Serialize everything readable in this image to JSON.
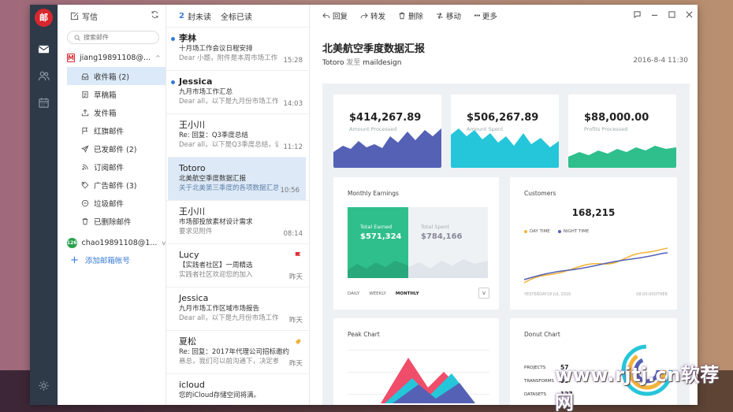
{
  "app": {
    "logo": "邮"
  },
  "sidebar": {
    "compose_label": "写信",
    "search_placeholder": "搜索邮件",
    "account1": "jiang19891108@...",
    "folders": [
      {
        "label": "收件箱 (2)",
        "icon": "inbox-icon"
      },
      {
        "label": "草稿箱",
        "icon": "draft-icon"
      },
      {
        "label": "发件箱",
        "icon": "outbox-icon"
      },
      {
        "label": "红旗邮件",
        "icon": "flag-icon"
      },
      {
        "label": "已发邮件 (2)",
        "icon": "send-icon"
      },
      {
        "label": "订阅邮件",
        "icon": "rss-icon"
      },
      {
        "label": "广告邮件 (3)",
        "icon": "tag-icon"
      },
      {
        "label": "垃圾邮件",
        "icon": "block-icon"
      },
      {
        "label": "已删除邮件",
        "icon": "trash-icon"
      }
    ],
    "account2_badge": "126",
    "account2": "chao19891108@1...",
    "add_account": "添加邮箱帐号"
  },
  "list_header": {
    "count": "2",
    "unread_label": "封未读",
    "mark_all": "全标已读"
  },
  "mails": [
    {
      "from": "李林",
      "subject": "十月场工作会议日程安排",
      "preview": "Dear 小题，附件是本周市场工作...",
      "time": "15:28",
      "unread": true
    },
    {
      "from": "Jessica",
      "subject": "九月市场工作汇总",
      "preview": "Dear all，以下是九月份市场工作...",
      "time": "14:03",
      "unread": true
    },
    {
      "from": "王小川",
      "subject": "Re: 回复：Q3季度总结",
      "preview": "Dear all，以下是Q3季度总结，请...",
      "time": "11:12"
    },
    {
      "from": "Totoro",
      "subject": "北美航空季度数据汇报",
      "preview": "关于北美第三季度的各项数据汇总...",
      "time": "10:56",
      "selected": true
    },
    {
      "from": "王小川",
      "subject": "市场部投放素材设计需求",
      "preview": "要求见附件",
      "time": "08:14"
    },
    {
      "from": "Lucy",
      "subject": "【实践者社区】一周精选",
      "preview": "实践者社区欢迎您的加入",
      "time": "昨天",
      "flag": "red"
    },
    {
      "from": "Jessica",
      "subject": "九月市场工作区域市场报告",
      "preview": "Dear all，以下是九月份市场工作...",
      "time": "昨天"
    },
    {
      "from": "夏松",
      "subject": "Re: 回复：2017年代理公司招标邀约",
      "preview": "悬总，我们可以前沟通下，决定参加的...",
      "time": "昨天",
      "flag": "orange"
    },
    {
      "from": "icloud",
      "subject": "您的iCloud存储空间将满。",
      "preview": "",
      "time": ""
    }
  ],
  "toolbar": {
    "reply": "回复",
    "forward": "转发",
    "delete": "删除",
    "move": "移动",
    "more": "更多"
  },
  "message": {
    "title": "北美航空季度数据汇报",
    "sender": "Totoro",
    "sent_to_label": "发至",
    "recipient": "maildesign",
    "date": "2016-8-4  11:30"
  },
  "dashboard": {
    "stats": [
      {
        "value": "$414,267.89",
        "label": "Amount Processed",
        "color": "#5561b5"
      },
      {
        "value": "$506,267.89",
        "label": "Amount Spent",
        "color": "#26c6da"
      },
      {
        "value": "$88,000.00",
        "label": "Profits Processed",
        "color": "#2fbf8c"
      }
    ],
    "earnings": {
      "title": "Monthly Earnings",
      "earned_label": "Total Earned",
      "earned": "$571,324",
      "spent_label": "Total Spent",
      "spent": "$784,166",
      "tabs": [
        "DAILY",
        "WEEKLY",
        "MONTHLY"
      ]
    },
    "customers": {
      "title": "Customers",
      "count": "168,215",
      "legend": [
        "DAY TIME",
        "NIGHT TIME"
      ],
      "dates": [
        "YESTERDAY",
        "18 JUL 2016",
        "08:00:00",
        "OTHER"
      ]
    },
    "peak": {
      "title": "Peak Chart",
      "ticks": [
        "",
        "",
        ""
      ]
    },
    "donut": {
      "title": "Donut Chart",
      "rows": [
        {
          "label": "PROJECTS",
          "value": "57"
        },
        {
          "label": "TRANSFORMS",
          "value": "95"
        },
        {
          "label": "DATASETS",
          "value": "127"
        }
      ]
    }
  },
  "watermark": "www.rjtj.cn软荐网"
}
